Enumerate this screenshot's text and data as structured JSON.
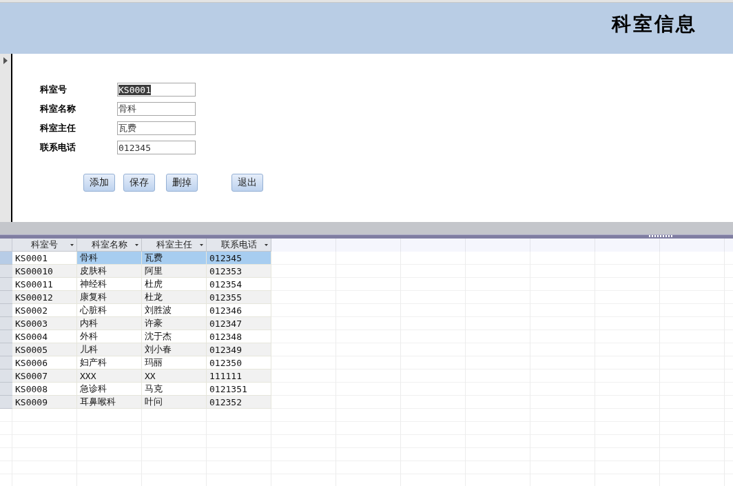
{
  "header": {
    "title": "科室信息"
  },
  "form": {
    "fields": [
      {
        "label": "科室号",
        "value": "KS0001",
        "selected": true
      },
      {
        "label": "科室名称",
        "value": "骨科",
        "selected": false
      },
      {
        "label": "科室主任",
        "value": "瓦费",
        "selected": false
      },
      {
        "label": "联系电话",
        "value": "012345",
        "selected": false
      }
    ],
    "buttons": [
      "添加",
      "保存",
      "删掉",
      "退出"
    ]
  },
  "table": {
    "columns": [
      "科室号",
      "科室名称",
      "科室主任",
      "联系电话"
    ],
    "rows": [
      {
        "cells": [
          "KS0001",
          "骨科",
          "瓦费",
          "012345"
        ],
        "selected": true
      },
      {
        "cells": [
          "KS00010",
          "皮肤科",
          "阿里",
          "012353"
        ],
        "selected": false
      },
      {
        "cells": [
          "KS00011",
          "神经科",
          "杜虎",
          "012354"
        ],
        "selected": false
      },
      {
        "cells": [
          "KS00012",
          "康复科",
          "杜龙",
          "012355"
        ],
        "selected": false
      },
      {
        "cells": [
          "KS0002",
          "心脏科",
          "刘胜波",
          "012346"
        ],
        "selected": false
      },
      {
        "cells": [
          "KS0003",
          "内科",
          "许豪",
          "012347"
        ],
        "selected": false
      },
      {
        "cells": [
          "KS0004",
          "外科",
          "沈于杰",
          "012348"
        ],
        "selected": false
      },
      {
        "cells": [
          "KS0005",
          "儿科",
          "刘小春",
          "012349"
        ],
        "selected": false
      },
      {
        "cells": [
          "KS0006",
          "妇产科",
          "玛丽",
          "012350"
        ],
        "selected": false
      },
      {
        "cells": [
          "KS0007",
          "XXX",
          "XX",
          "111111"
        ],
        "selected": false
      },
      {
        "cells": [
          "KS0008",
          "急诊科",
          "马克",
          "0121351"
        ],
        "selected": false
      },
      {
        "cells": [
          "KS0009",
          "耳鼻喉科",
          "叶问",
          "012352"
        ],
        "selected": false
      }
    ]
  }
}
